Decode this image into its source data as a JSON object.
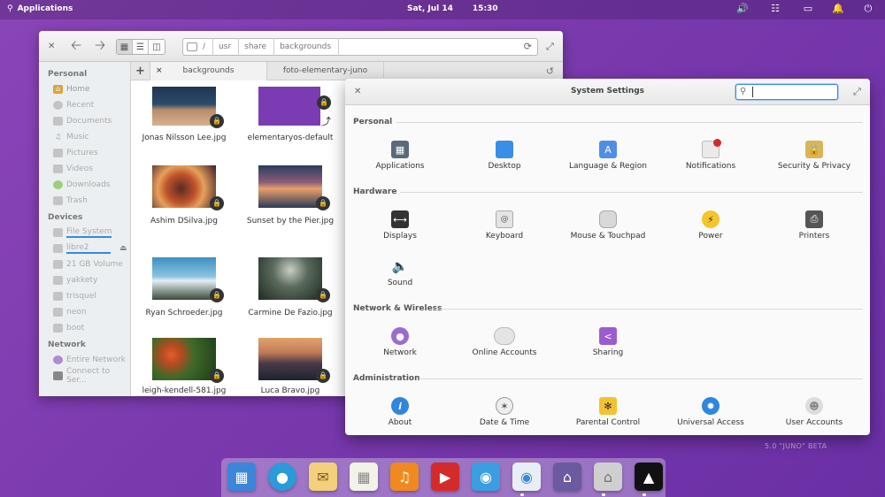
{
  "panel": {
    "apps_label": "Applications",
    "date": "Sat, Jul 14",
    "time": "15:30"
  },
  "desktop": {
    "version_label": "5.0 \"JUNO\" BETA"
  },
  "files": {
    "path": [
      "usr",
      "share",
      "backgrounds"
    ],
    "path_root": "/",
    "sidebar": {
      "personal_header": "Personal",
      "personal": [
        "Home",
        "Recent",
        "Documents",
        "Music",
        "Pictures",
        "Videos",
        "Downloads",
        "Trash"
      ],
      "devices_header": "Devices",
      "devices": [
        "File System",
        "libre2",
        "21 GB Volume",
        "yakkety",
        "trisquel",
        "neon",
        "boot"
      ],
      "network_header": "Network",
      "network": [
        "Entire Network",
        "Connect to Ser..."
      ]
    },
    "tabs": {
      "add": "+",
      "close": "×",
      "tab1": "backgrounds",
      "tab2": "foto-elementary-juno"
    },
    "items": [
      "Jonas Nilsson Lee.jpg",
      "elementaryos-default",
      "Ashim DSilva.jpg",
      "Sunset by the Pier.jpg",
      "Ryan Schroeder.jpg",
      "Carmine De Fazio.jpg",
      "leigh-kendell-581.jpg",
      "Luca Bravo.jpg"
    ]
  },
  "settings": {
    "title": "System Settings",
    "search_value": "",
    "sections": {
      "personal": {
        "title": "Personal",
        "items": [
          "Applications",
          "Desktop",
          "Language & Region",
          "Notifications",
          "Security & Privacy"
        ]
      },
      "hardware": {
        "title": "Hardware",
        "items": [
          "Displays",
          "Keyboard",
          "Mouse & Touchpad",
          "Power",
          "Printers",
          "Sound"
        ]
      },
      "network": {
        "title": "Network & Wireless",
        "items": [
          "Network",
          "Online Accounts",
          "Sharing"
        ]
      },
      "admin": {
        "title": "Administration",
        "items": [
          "About",
          "Date & Time",
          "Parental Control",
          "Universal Access",
          "User Accounts"
        ]
      }
    }
  },
  "dock": [
    "multitasking-view",
    "web-browser",
    "mail",
    "calendar",
    "music",
    "videos",
    "photos",
    "system-settings",
    "appcenter",
    "files",
    "inkscape"
  ]
}
